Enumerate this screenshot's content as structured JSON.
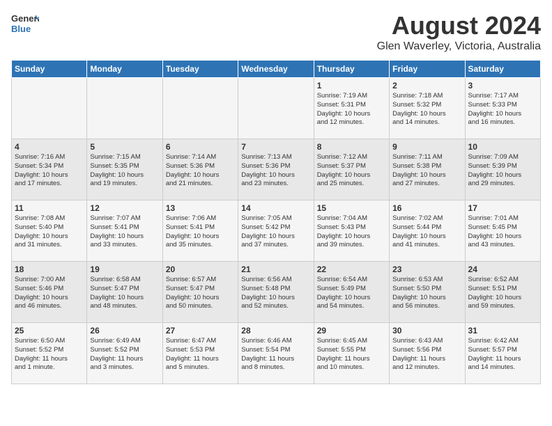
{
  "header": {
    "logo_general": "General",
    "logo_blue": "Blue",
    "month_title": "August 2024",
    "subtitle": "Glen Waverley, Victoria, Australia"
  },
  "weekdays": [
    "Sunday",
    "Monday",
    "Tuesday",
    "Wednesday",
    "Thursday",
    "Friday",
    "Saturday"
  ],
  "weeks": [
    [
      {
        "day": "",
        "info": ""
      },
      {
        "day": "",
        "info": ""
      },
      {
        "day": "",
        "info": ""
      },
      {
        "day": "",
        "info": ""
      },
      {
        "day": "1",
        "info": "Sunrise: 7:19 AM\nSunset: 5:31 PM\nDaylight: 10 hours\nand 12 minutes."
      },
      {
        "day": "2",
        "info": "Sunrise: 7:18 AM\nSunset: 5:32 PM\nDaylight: 10 hours\nand 14 minutes."
      },
      {
        "day": "3",
        "info": "Sunrise: 7:17 AM\nSunset: 5:33 PM\nDaylight: 10 hours\nand 16 minutes."
      }
    ],
    [
      {
        "day": "4",
        "info": "Sunrise: 7:16 AM\nSunset: 5:34 PM\nDaylight: 10 hours\nand 17 minutes."
      },
      {
        "day": "5",
        "info": "Sunrise: 7:15 AM\nSunset: 5:35 PM\nDaylight: 10 hours\nand 19 minutes."
      },
      {
        "day": "6",
        "info": "Sunrise: 7:14 AM\nSunset: 5:36 PM\nDaylight: 10 hours\nand 21 minutes."
      },
      {
        "day": "7",
        "info": "Sunrise: 7:13 AM\nSunset: 5:36 PM\nDaylight: 10 hours\nand 23 minutes."
      },
      {
        "day": "8",
        "info": "Sunrise: 7:12 AM\nSunset: 5:37 PM\nDaylight: 10 hours\nand 25 minutes."
      },
      {
        "day": "9",
        "info": "Sunrise: 7:11 AM\nSunset: 5:38 PM\nDaylight: 10 hours\nand 27 minutes."
      },
      {
        "day": "10",
        "info": "Sunrise: 7:09 AM\nSunset: 5:39 PM\nDaylight: 10 hours\nand 29 minutes."
      }
    ],
    [
      {
        "day": "11",
        "info": "Sunrise: 7:08 AM\nSunset: 5:40 PM\nDaylight: 10 hours\nand 31 minutes."
      },
      {
        "day": "12",
        "info": "Sunrise: 7:07 AM\nSunset: 5:41 PM\nDaylight: 10 hours\nand 33 minutes."
      },
      {
        "day": "13",
        "info": "Sunrise: 7:06 AM\nSunset: 5:41 PM\nDaylight: 10 hours\nand 35 minutes."
      },
      {
        "day": "14",
        "info": "Sunrise: 7:05 AM\nSunset: 5:42 PM\nDaylight: 10 hours\nand 37 minutes."
      },
      {
        "day": "15",
        "info": "Sunrise: 7:04 AM\nSunset: 5:43 PM\nDaylight: 10 hours\nand 39 minutes."
      },
      {
        "day": "16",
        "info": "Sunrise: 7:02 AM\nSunset: 5:44 PM\nDaylight: 10 hours\nand 41 minutes."
      },
      {
        "day": "17",
        "info": "Sunrise: 7:01 AM\nSunset: 5:45 PM\nDaylight: 10 hours\nand 43 minutes."
      }
    ],
    [
      {
        "day": "18",
        "info": "Sunrise: 7:00 AM\nSunset: 5:46 PM\nDaylight: 10 hours\nand 46 minutes."
      },
      {
        "day": "19",
        "info": "Sunrise: 6:58 AM\nSunset: 5:47 PM\nDaylight: 10 hours\nand 48 minutes."
      },
      {
        "day": "20",
        "info": "Sunrise: 6:57 AM\nSunset: 5:47 PM\nDaylight: 10 hours\nand 50 minutes."
      },
      {
        "day": "21",
        "info": "Sunrise: 6:56 AM\nSunset: 5:48 PM\nDaylight: 10 hours\nand 52 minutes."
      },
      {
        "day": "22",
        "info": "Sunrise: 6:54 AM\nSunset: 5:49 PM\nDaylight: 10 hours\nand 54 minutes."
      },
      {
        "day": "23",
        "info": "Sunrise: 6:53 AM\nSunset: 5:50 PM\nDaylight: 10 hours\nand 56 minutes."
      },
      {
        "day": "24",
        "info": "Sunrise: 6:52 AM\nSunset: 5:51 PM\nDaylight: 10 hours\nand 59 minutes."
      }
    ],
    [
      {
        "day": "25",
        "info": "Sunrise: 6:50 AM\nSunset: 5:52 PM\nDaylight: 11 hours\nand 1 minute."
      },
      {
        "day": "26",
        "info": "Sunrise: 6:49 AM\nSunset: 5:52 PM\nDaylight: 11 hours\nand 3 minutes."
      },
      {
        "day": "27",
        "info": "Sunrise: 6:47 AM\nSunset: 5:53 PM\nDaylight: 11 hours\nand 5 minutes."
      },
      {
        "day": "28",
        "info": "Sunrise: 6:46 AM\nSunset: 5:54 PM\nDaylight: 11 hours\nand 8 minutes."
      },
      {
        "day": "29",
        "info": "Sunrise: 6:45 AM\nSunset: 5:55 PM\nDaylight: 11 hours\nand 10 minutes."
      },
      {
        "day": "30",
        "info": "Sunrise: 6:43 AM\nSunset: 5:56 PM\nDaylight: 11 hours\nand 12 minutes."
      },
      {
        "day": "31",
        "info": "Sunrise: 6:42 AM\nSunset: 5:57 PM\nDaylight: 11 hours\nand 14 minutes."
      }
    ]
  ]
}
